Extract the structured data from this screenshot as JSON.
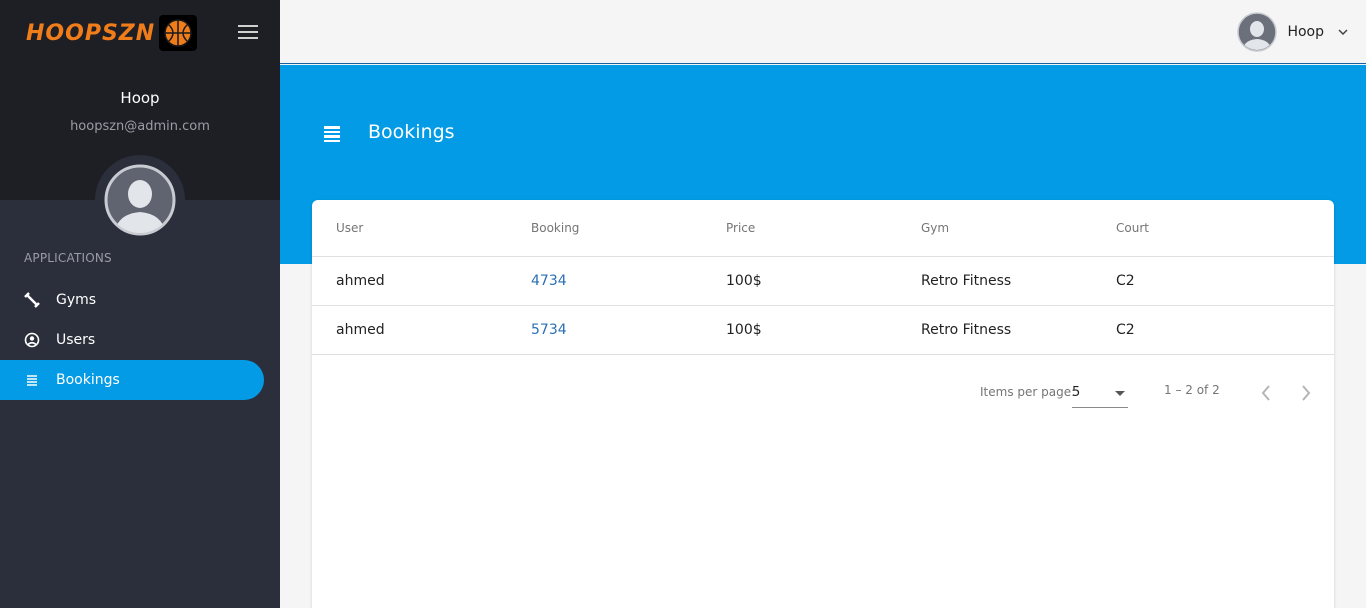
{
  "brand": {
    "logo_text": "HOOPSZN"
  },
  "sidebar": {
    "user_name": "Hoop",
    "user_email": "hoopszn@admin.com",
    "section_title": "APPLICATIONS",
    "items": [
      {
        "label": "Gyms",
        "icon": "dumbbell-icon"
      },
      {
        "label": "Users",
        "icon": "user-circle-icon"
      },
      {
        "label": "Bookings",
        "icon": "list-icon",
        "active": true
      }
    ]
  },
  "topbar": {
    "user_name": "Hoop"
  },
  "page": {
    "title": "Bookings"
  },
  "table": {
    "columns": [
      "User",
      "Booking",
      "Price",
      "Gym",
      "Court"
    ],
    "rows": [
      {
        "user": "ahmed",
        "booking": "4734",
        "price": "100$",
        "gym": "Retro Fitness",
        "court": "C2"
      },
      {
        "user": "ahmed",
        "booking": "5734",
        "price": "100$",
        "gym": "Retro Fitness",
        "court": "C2"
      }
    ]
  },
  "paginator": {
    "items_per_page_label": "Items per page:",
    "items_per_page_value": "5",
    "range_label": "1 – 2 of 2"
  },
  "colors": {
    "accent": "#039be5",
    "sidebar_bg": "#2b2e3b",
    "sidebar_top_bg": "#1e1f25",
    "link": "#2a6fb5",
    "brand_orange": "#f07d1a"
  }
}
